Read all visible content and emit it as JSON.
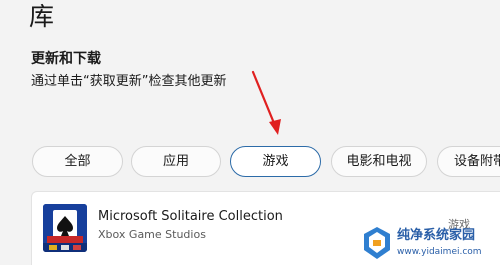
{
  "page": {
    "title": "库"
  },
  "updates": {
    "heading": "更新和下载",
    "hint": "通过单击“获取更新”检查其他更新"
  },
  "filters": [
    {
      "label": "全部",
      "selected": false
    },
    {
      "label": "应用",
      "selected": false
    },
    {
      "label": "游戏",
      "selected": true
    },
    {
      "label": "电影和电视",
      "selected": false
    },
    {
      "label": "设备附带",
      "selected": false
    }
  ],
  "library": {
    "items": [
      {
        "name": "Microsoft Solitaire Collection",
        "publisher": "Xbox Game Studios",
        "category": "游戏",
        "icon": "solitaire-app-icon"
      }
    ]
  },
  "annotation": {
    "arrow_color": "#e02020"
  },
  "watermark": {
    "name": "纯净系统家园",
    "url": "www.yidaimei.com"
  },
  "colors": {
    "background": "#f3f3f3",
    "selected_border": "#2c6ba8",
    "pill_border": "#d4d4d4"
  }
}
